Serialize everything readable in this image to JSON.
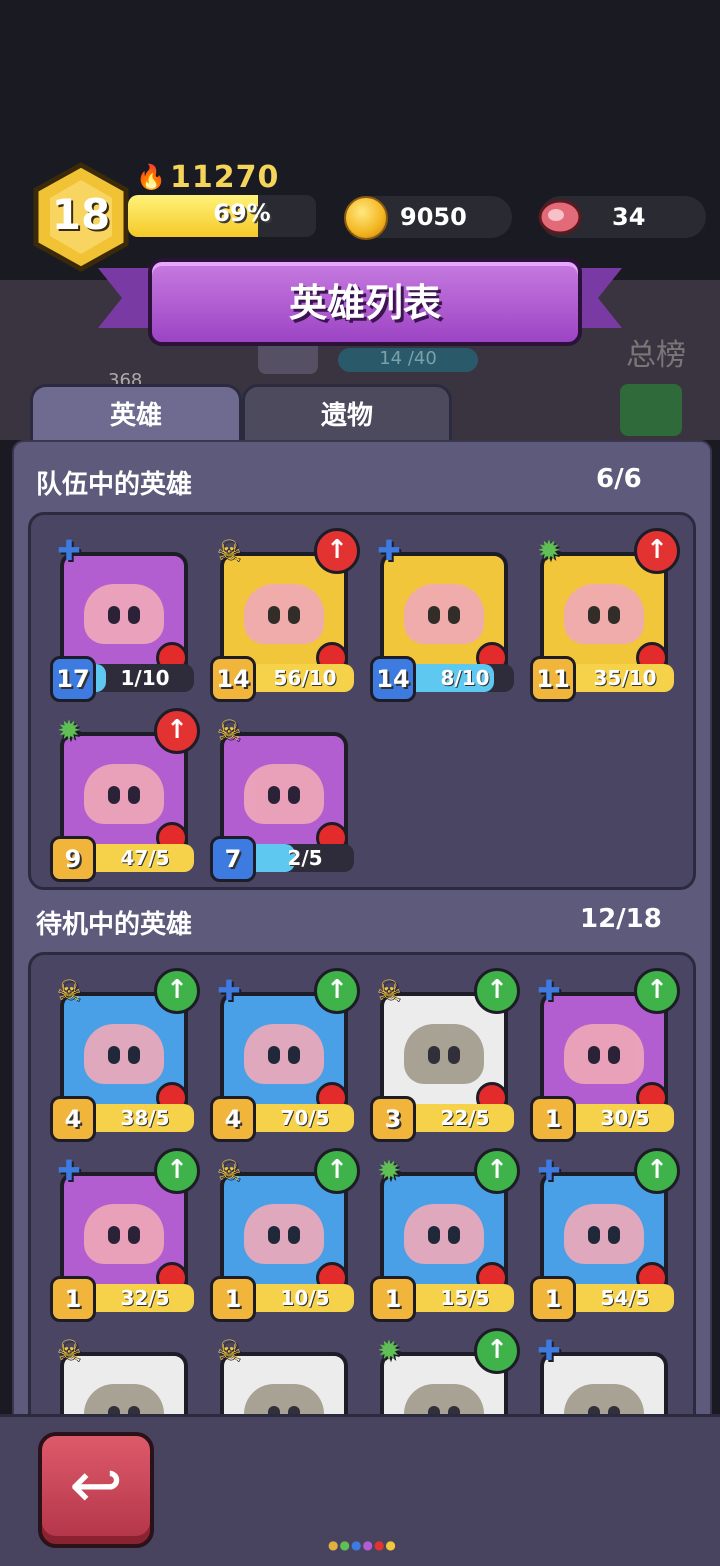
{
  "player": {
    "level": "18",
    "power": "11270",
    "xp_percent_label": "69%",
    "xp_fraction": 0.69,
    "coins": "9050",
    "meat": "34"
  },
  "screen_title": "英雄列表",
  "tabs": [
    {
      "label": "英雄",
      "active": true
    },
    {
      "label": "遗物",
      "active": false
    }
  ],
  "background_hints": {
    "ghost_counter": "14 /40",
    "ghost_text": "368",
    "ghost_rank": "总榜"
  },
  "team": {
    "title": "队伍中的英雄",
    "count": "6/6",
    "heroes": [
      {
        "level": "17",
        "shards": "1/10",
        "class": "blue",
        "upgrade": false,
        "bg": "#b25ed0"
      },
      {
        "level": "14",
        "shards": "56/10",
        "class": "yellow",
        "upgrade": true,
        "bg": "#f2c63a"
      },
      {
        "level": "14",
        "shards": "8/10",
        "class": "blue",
        "upgrade": false,
        "bg": "#f2c63a"
      },
      {
        "level": "11",
        "shards": "35/10",
        "class": "green",
        "upgrade": true,
        "bg": "#f2c63a"
      },
      {
        "level": "9",
        "shards": "47/5",
        "class": "green",
        "upgrade": true,
        "bg": "#b25ed0"
      },
      {
        "level": "7",
        "shards": "2/5",
        "class": "yellow",
        "upgrade": false,
        "bg": "#b25ed0"
      }
    ]
  },
  "standby": {
    "title": "待机中的英雄",
    "count": "12/18",
    "heroes": [
      {
        "level": "4",
        "shards": "38/5",
        "class": "yellow",
        "upgrade": true,
        "bg": "#4aa0e6"
      },
      {
        "level": "4",
        "shards": "70/5",
        "class": "blue",
        "upgrade": true,
        "bg": "#4aa0e6"
      },
      {
        "level": "3",
        "shards": "22/5",
        "class": "yellow",
        "upgrade": true,
        "bg": "#ececec"
      },
      {
        "level": "1",
        "shards": "30/5",
        "class": "blue",
        "upgrade": true,
        "bg": "#b25ed0"
      },
      {
        "level": "1",
        "shards": "32/5",
        "class": "blue",
        "upgrade": true,
        "bg": "#b25ed0"
      },
      {
        "level": "1",
        "shards": "10/5",
        "class": "yellow",
        "upgrade": true,
        "bg": "#4aa0e6"
      },
      {
        "level": "1",
        "shards": "15/5",
        "class": "green",
        "upgrade": true,
        "bg": "#4aa0e6"
      },
      {
        "level": "1",
        "shards": "54/5",
        "class": "blue",
        "upgrade": true,
        "bg": "#4aa0e6"
      },
      {
        "level": "",
        "shards": "",
        "class": "yellow",
        "upgrade": false,
        "bg": "#ececec"
      },
      {
        "level": "",
        "shards": "",
        "class": "yellow",
        "upgrade": false,
        "bg": "#ececec"
      },
      {
        "level": "",
        "shards": "",
        "class": "green",
        "upgrade": true,
        "bg": "#ececec"
      },
      {
        "level": "",
        "shards": "",
        "class": "blue",
        "upgrade": false,
        "bg": "#ececec"
      }
    ]
  },
  "icons": {
    "back": "back-arrow-icon",
    "class_yellow": "crossbones-icon",
    "class_blue": "cross-icon",
    "class_green": "gear-skull-icon",
    "upgrade_red": "arrow-up-icon",
    "upgrade_green": "arrow-up-icon"
  },
  "colors": {
    "class_yellow": "#f2c63a",
    "class_blue": "#3e7be0",
    "class_green": "#5fbe54",
    "upgrade_red": "#e33232",
    "upgrade_green": "#3fb24a",
    "bar_yellow": "#f5d24a",
    "bar_blue": "#5ec8f0",
    "bar_dark": "#2e2c3a"
  }
}
